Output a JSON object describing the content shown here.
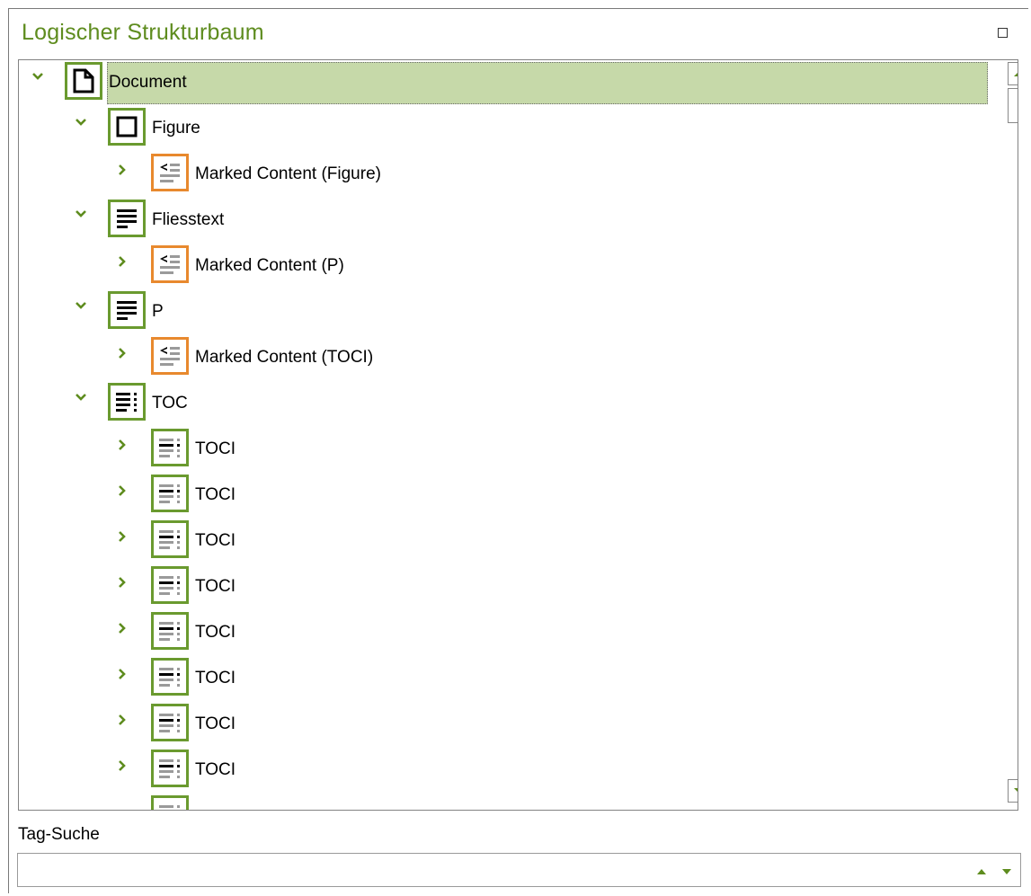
{
  "panel": {
    "title": "Logischer Strukturbaum"
  },
  "tree": {
    "nodes": [
      {
        "label": "Document",
        "expanded": true,
        "icon": "document-icon",
        "level": 0,
        "selected": true
      },
      {
        "label": "Figure",
        "expanded": true,
        "icon": "figure-icon",
        "level": 1
      },
      {
        "label": "Marked Content (Figure)",
        "expanded": false,
        "icon": "marked-content-icon",
        "level": 2
      },
      {
        "label": "Fliesstext",
        "expanded": true,
        "icon": "paragraph-icon",
        "level": 1
      },
      {
        "label": "Marked Content (P)",
        "expanded": false,
        "icon": "marked-content-icon",
        "level": 2
      },
      {
        "label": "P",
        "expanded": true,
        "icon": "paragraph-icon",
        "level": 1
      },
      {
        "label": "Marked Content (TOCI)",
        "expanded": false,
        "icon": "marked-content-icon",
        "level": 2
      },
      {
        "label": "TOC",
        "expanded": true,
        "icon": "toc-icon",
        "level": 1
      },
      {
        "label": "TOCI",
        "expanded": false,
        "icon": "toci-icon",
        "level": 2
      },
      {
        "label": "TOCI",
        "expanded": false,
        "icon": "toci-icon",
        "level": 2
      },
      {
        "label": "TOCI",
        "expanded": false,
        "icon": "toci-icon",
        "level": 2
      },
      {
        "label": "TOCI",
        "expanded": false,
        "icon": "toci-icon",
        "level": 2
      },
      {
        "label": "TOCI",
        "expanded": false,
        "icon": "toci-icon",
        "level": 2
      },
      {
        "label": "TOCI",
        "expanded": false,
        "icon": "toci-icon",
        "level": 2
      },
      {
        "label": "TOCI",
        "expanded": false,
        "icon": "toci-icon",
        "level": 2
      },
      {
        "label": "TOCI",
        "expanded": false,
        "icon": "toci-icon",
        "level": 2
      }
    ]
  },
  "search": {
    "label": "Tag-Suche",
    "value": "",
    "placeholder": ""
  },
  "colors": {
    "accent_green": "#5e8c1e",
    "icon_border_green": "#6a9a2f",
    "icon_border_orange": "#e8892e",
    "selection_bg": "#c6d9a9"
  }
}
